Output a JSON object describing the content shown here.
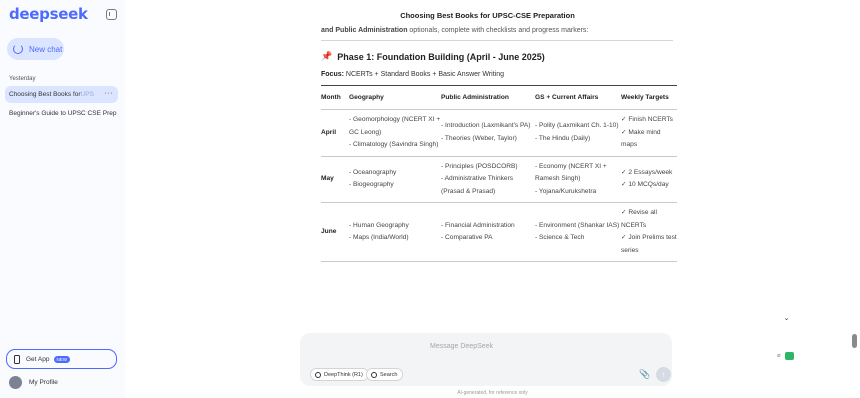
{
  "sidebar": {
    "logo": "deepseek",
    "new_chat": "New chat",
    "section": "Yesterday",
    "history": [
      {
        "label_main": "Choosing Best Books for ",
        "label_fade": "UPS",
        "more": "···"
      },
      {
        "label_main": "Beginner's Guide to UPSC CSE Prep"
      }
    ],
    "get_app": "Get App",
    "get_app_badge": "NEW",
    "profile": "My Profile"
  },
  "main": {
    "title": "Choosing Best Books for UPSC-CSE Preparation",
    "intro_bold": "and Public Administration",
    "intro_rest": " optionals, complete with checklists and progress markers:",
    "phase_title": "Phase 1: Foundation Building (April - June 2025)",
    "focus_label": "Focus:",
    "focus_text": " NCERTs + Standard Books + Basic Answer Writing",
    "table": {
      "headers": [
        "Month",
        "Geography",
        "Public Administration",
        "GS + Current Affairs",
        "Weekly Targets"
      ],
      "rows": [
        {
          "month": "April",
          "geo": [
            "- Geomorphology (NCERT XI + GC Leong)",
            "- Climatology (Savindra Singh)"
          ],
          "pa": [
            "- Introduction (Laxmikant's PA)",
            "- Theories (Weber, Taylor)"
          ],
          "gs": [
            "- Polity (Laxmikant Ch. 1-10)",
            "- The Hindu (Daily)"
          ],
          "targets": [
            "✓ Finish NCERTs",
            "✓ Make mind maps"
          ]
        },
        {
          "month": "May",
          "geo": [
            "- Oceanography",
            "- Biogeography"
          ],
          "pa": [
            "- Principles (POSDCORB)",
            "- Administrative Thinkers (Prasad & Prasad)"
          ],
          "gs": [
            "- Economy (NCERT XI + Ramesh Singh)",
            "- Yojana/Kurukshetra"
          ],
          "targets": [
            "✓ 2 Essays/week",
            "✓ 10 MCQs/day"
          ]
        },
        {
          "month": "June",
          "geo": [
            "- Human Geography",
            "- Maps (India/World)"
          ],
          "pa": [
            "- Financial Administration",
            "- Comparative PA"
          ],
          "gs": [
            "- Environment (Shankar IAS)",
            "- Science & Tech"
          ],
          "targets": [
            "✓ Revise all NCERTs",
            "✓ Join Prelims test series"
          ]
        }
      ]
    }
  },
  "composer": {
    "placeholder": "Message DeepSeek",
    "deepthink": "DeepThink (R1)",
    "search": "Search"
  },
  "footer": "AI-generated, for reference only",
  "colors": {
    "accent": "#4d6bfe",
    "sidebar_bg": "#f9fbff",
    "active_bg": "#dbe5ff"
  }
}
